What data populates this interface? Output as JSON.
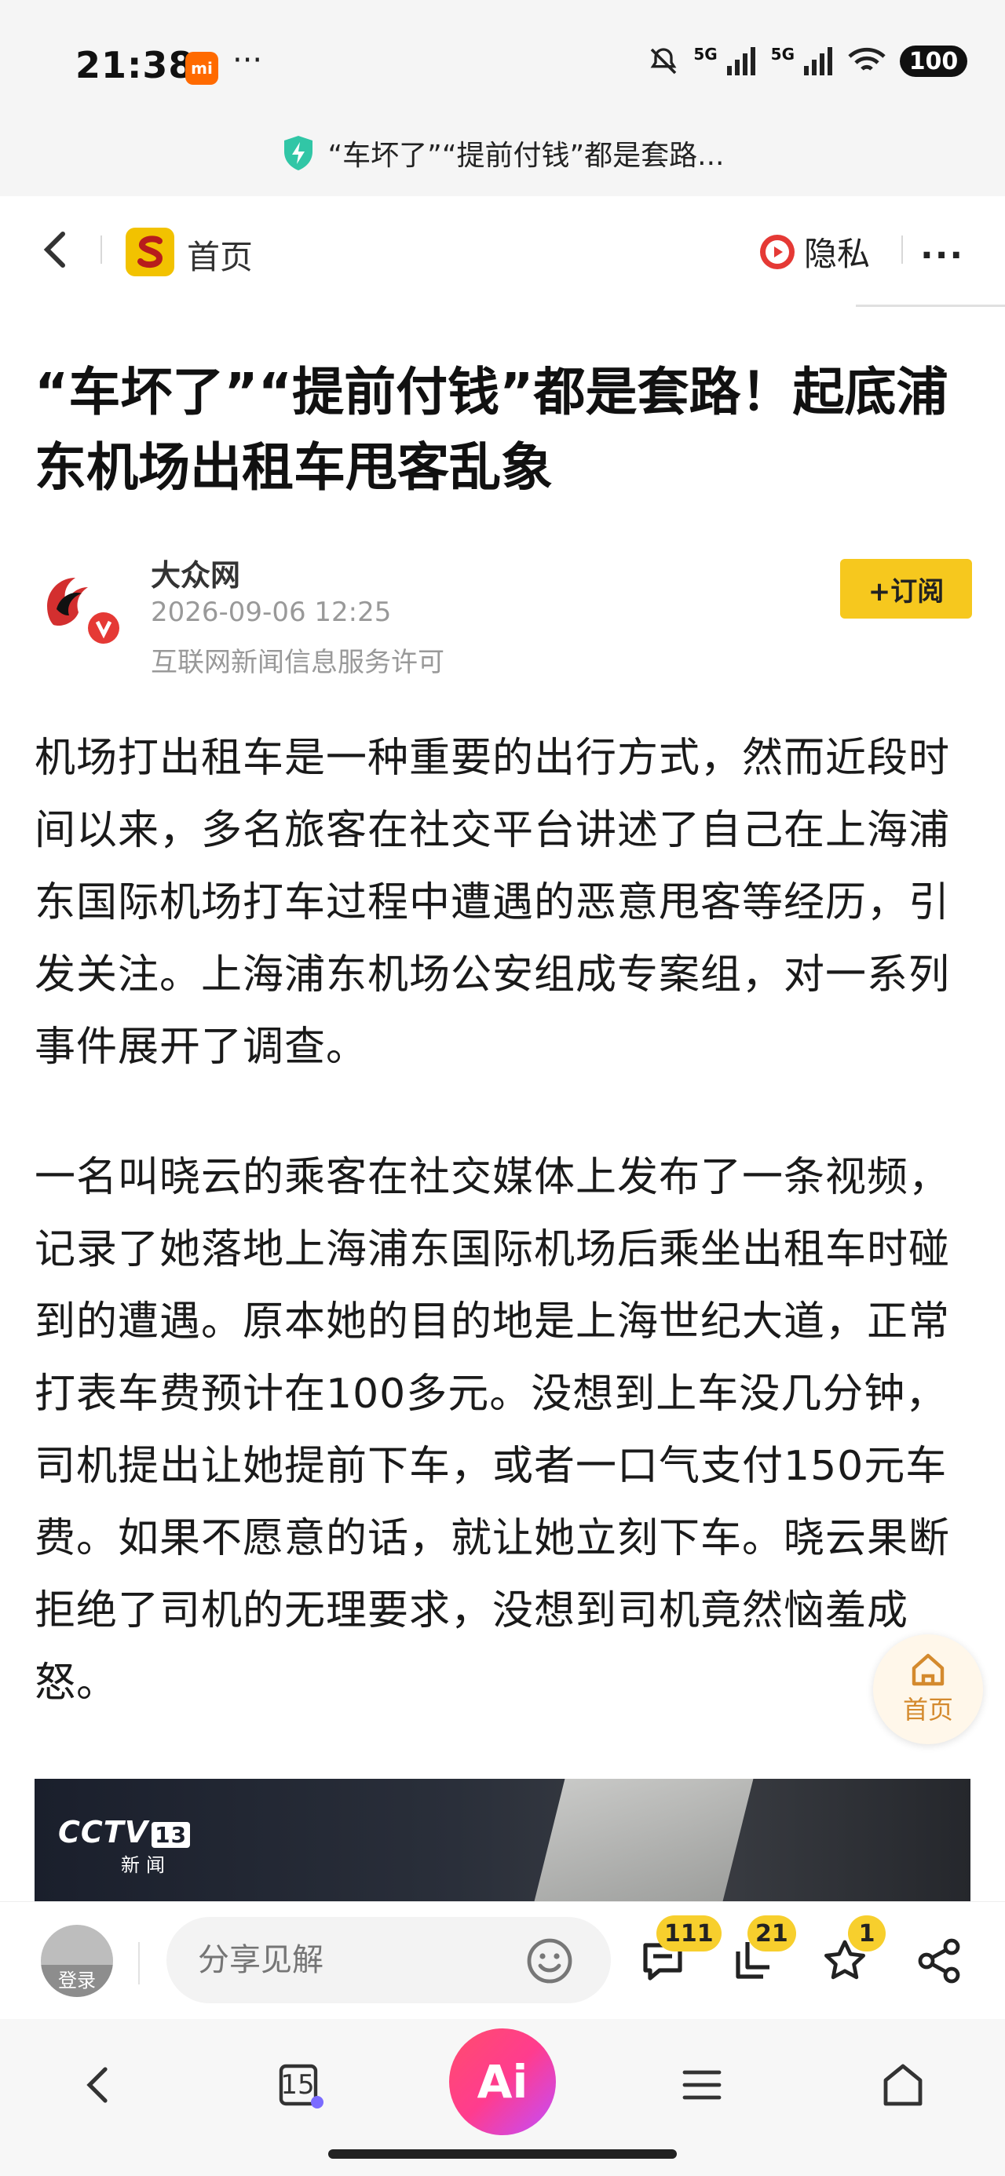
{
  "status_bar": {
    "time": "21:38",
    "app_badge": "mi",
    "more_dots": "···",
    "signal_1": "5G",
    "signal_2": "5G",
    "battery": "100"
  },
  "url_bar": {
    "title": "“车坏了”“提前付钱”都是套路..."
  },
  "nav": {
    "home_label": "首页",
    "privacy_label": "隐私",
    "more": "···"
  },
  "article": {
    "title": "“车坏了”“提前付钱”都是套路！起底浦东机场出租车甩客乱象",
    "author": "大众网",
    "publish_time": "2026-09-06 12:25",
    "license": "互联网新闻信息服务许可",
    "subscribe_label": "+订阅",
    "paragraphs": [
      "机场打出租车是一种重要的出行方式，然而近段时间以来，多名旅客在社交平台讲述了自己在上海浦东国际机场打车过程中遭遇的恶意甩客等经历，引发关注。上海浦东机场公安组成专案组，对一系列事件展开了调查。",
      "一名叫晓云的乘客在社交媒体上发布了一条视频，记录了她落地上海浦东国际机场后乘坐出租车时碰到的遭遇。原本她的目的地是上海世纪大道，正常打表车费预计在100多元。没想到上车没几分钟，司机提出让她提前下车，或者一口气支付150元车费。如果不愿意的话，就让她立刻下车。晓云果断拒绝了司机的无理要求，没想到司机竟然恼羞成怒。"
    ],
    "video": {
      "channel": "CCTV",
      "channel_num": "13",
      "channel_sub": "新闻"
    }
  },
  "float_home": {
    "label": "首页"
  },
  "comment_bar": {
    "login_label": "登录",
    "share_placeholder": "分享见解",
    "comments_count": "111",
    "reposts_count": "21",
    "favorites_count": "1"
  },
  "toolbar": {
    "tabs_count": "15",
    "ai_label": "Ai"
  },
  "colors": {
    "accent_yellow": "#f6c81e",
    "ai_gradient_start": "#ff4d6d",
    "ai_gradient_end": "#c24dff"
  }
}
